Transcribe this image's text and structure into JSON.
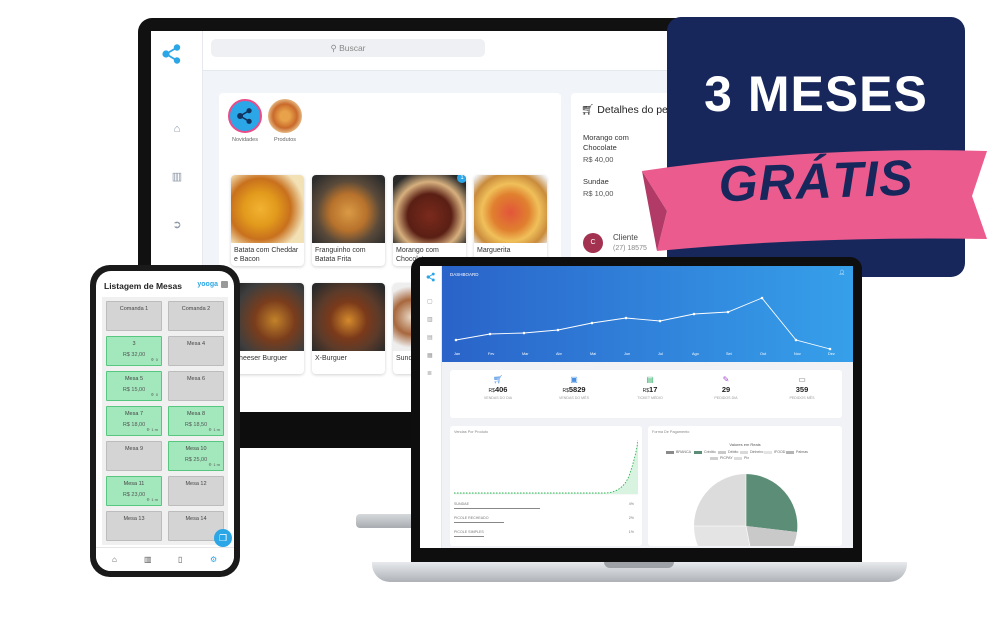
{
  "monitor": {
    "search_placeholder": "Buscar",
    "categories": [
      {
        "label": "Novidades"
      },
      {
        "label": "Produtos"
      }
    ],
    "products": [
      {
        "name": "Batata com Cheddar e Bacon"
      },
      {
        "name": "Franguinho com Batata Frita"
      },
      {
        "name": "Morango com Chocolate",
        "badge": "1"
      },
      {
        "name": "Marguerita"
      },
      {
        "name": "Cheeser Burguer"
      },
      {
        "name": "X-Burguer"
      },
      {
        "name": "Sundae"
      }
    ],
    "order_details": {
      "title": "Detalhes do pedido",
      "items": [
        {
          "name": "Morango com Chocolate",
          "price": "R$ 40,00"
        },
        {
          "name": "Sundae",
          "price": "R$ 10,00"
        }
      ],
      "customer": {
        "initial": "C",
        "label": "Cliente",
        "phone": "(27) 18575"
      }
    }
  },
  "banner": {
    "line1": "3 MESES",
    "line2": "GRÁTIS",
    "bg_color": "#17275c",
    "ribbon_color": "#ec5b8d"
  },
  "laptop": {
    "title": "DASHBOARD",
    "kpis": [
      {
        "currency": "R$",
        "value": "406",
        "label": "VENDAS DO DIA",
        "icon": "cart-icon",
        "color": "#4a90e2"
      },
      {
        "currency": "R$",
        "value": "5829",
        "label": "VENDAS DO MÊS",
        "icon": "store-icon",
        "color": "#4a90e2"
      },
      {
        "currency": "R$",
        "value": "17",
        "label": "TICKET MÉDIO",
        "icon": "receipt-icon",
        "color": "#3cb371"
      },
      {
        "currency": "",
        "value": "29",
        "label": "PEDIDOS DIA",
        "icon": "pencil-icon",
        "color": "#a64ac9"
      },
      {
        "currency": "",
        "value": "359",
        "label": "PEDIDOS MÊS",
        "icon": "bus-icon",
        "color": "#777777"
      }
    ],
    "header_chart": {
      "months": [
        "Jan",
        "Fev",
        "Mar",
        "Abr",
        "Mai",
        "Jun",
        "Jul",
        "Ago",
        "Set",
        "Out",
        "Nov",
        "Dez"
      ]
    },
    "left_panel": {
      "title": "Vendas Por Produto",
      "rows": [
        {
          "label": "SUNDAE",
          "pct": "4%"
        },
        {
          "label": "PICOLE RECHEADO",
          "pct": "2%"
        },
        {
          "label": "PICOLE SIMPLES",
          "pct": "1%"
        }
      ]
    },
    "right_panel": {
      "title": "Forma De Pagamento",
      "chart_title": "Valores em Reais",
      "legend": [
        {
          "label": "BRANCA",
          "color": "#8a8a8a"
        },
        {
          "label": "Crédito",
          "color": "#5c8d76"
        },
        {
          "label": "Débito",
          "color": "#c9c9c9"
        },
        {
          "label": "Dinheiro",
          "color": "#d9d9d9"
        },
        {
          "label": "IFOOD",
          "color": "#e4e4e4"
        },
        {
          "label": "Palmas",
          "color": "#b5b5b5"
        },
        {
          "label": "PICPAY",
          "color": "#cfcfcf"
        },
        {
          "label": "Pix",
          "color": "#dcdcdc"
        }
      ]
    }
  },
  "phone": {
    "title": "Listagem de Mesas",
    "brand": "yooga",
    "tables": [
      {
        "name": "Comanda 1",
        "status": "free",
        "value": "",
        "time": ""
      },
      {
        "name": "Comanda 2",
        "status": "free",
        "value": "",
        "time": ""
      },
      {
        "name": "3",
        "status": "busy",
        "value": "R$ 32,00",
        "time": "0"
      },
      {
        "name": "Mesa 4",
        "status": "free",
        "value": "",
        "time": ""
      },
      {
        "name": "Mesa 5",
        "status": "busy",
        "value": "R$ 15,00",
        "time": "0"
      },
      {
        "name": "Mesa 6",
        "status": "free",
        "value": "",
        "time": ""
      },
      {
        "name": "Mesa 7",
        "status": "busy",
        "value": "R$ 18,00",
        "time": "1 m"
      },
      {
        "name": "Mesa 8",
        "status": "busy",
        "value": "R$ 18,50",
        "time": "1 m"
      },
      {
        "name": "Mesa 9",
        "status": "free",
        "value": "",
        "time": ""
      },
      {
        "name": "Mesa 10",
        "status": "busy",
        "value": "R$ 25,00",
        "time": "1 m"
      },
      {
        "name": "Mesa 11",
        "status": "busy",
        "value": "R$ 23,00",
        "time": "1 m"
      },
      {
        "name": "Mesa 12",
        "status": "free",
        "value": "",
        "time": ""
      },
      {
        "name": "Mesa 13",
        "status": "free",
        "value": "",
        "time": ""
      },
      {
        "name": "Mesa 14",
        "status": "free",
        "value": "",
        "time": ""
      }
    ]
  }
}
